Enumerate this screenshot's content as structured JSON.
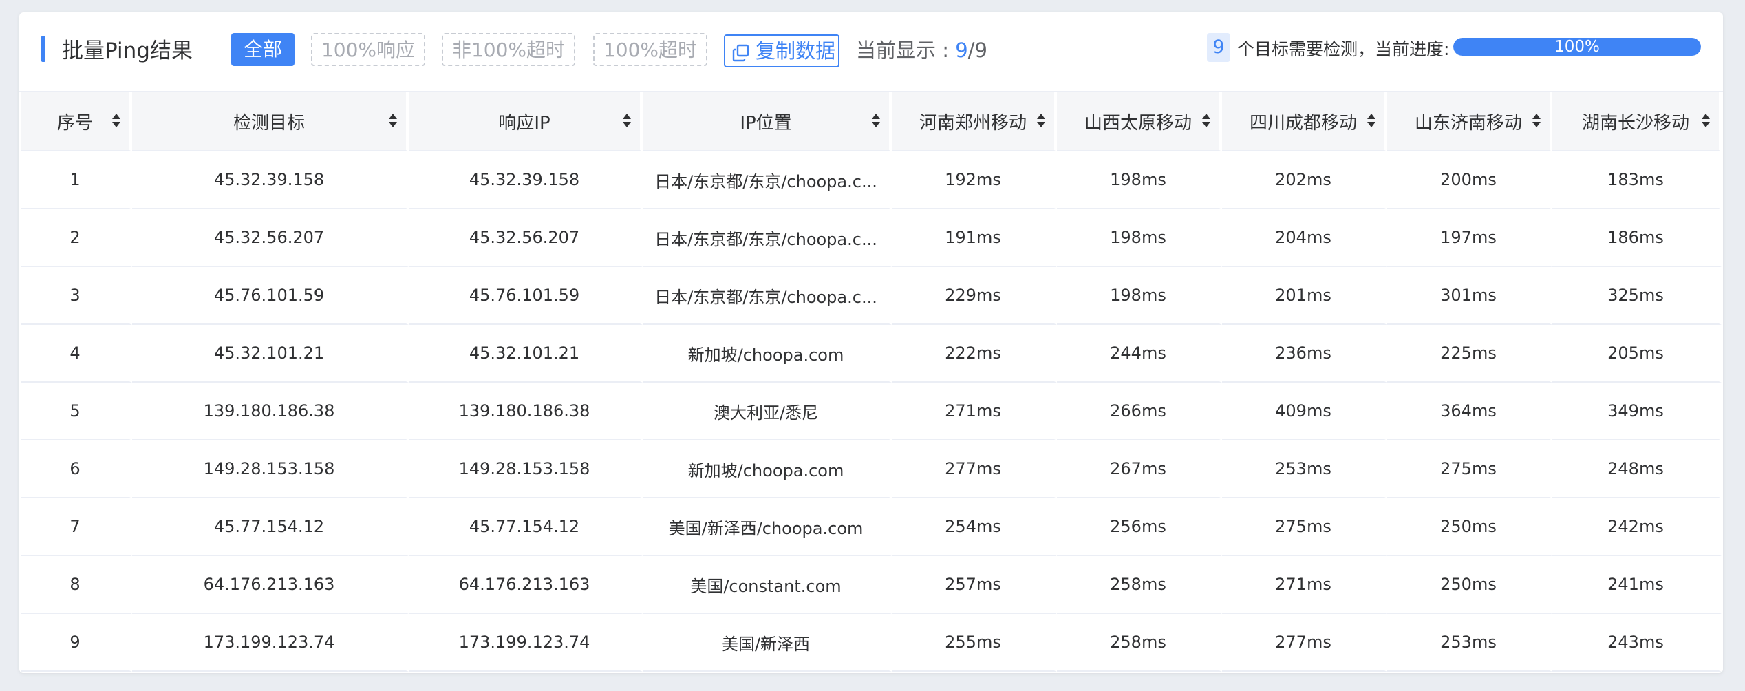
{
  "header": {
    "title": "批量Ping结果",
    "filters": [
      {
        "label": "全部",
        "active": true
      },
      {
        "label": "100%响应",
        "active": false
      },
      {
        "label": "非100%超时",
        "active": false
      },
      {
        "label": "100%超时",
        "active": false
      }
    ],
    "copy_label": "复制数据",
    "showing_label": "当前显示 :",
    "showing_current": "9",
    "showing_total": "9",
    "target_count": "9",
    "progress_text": "个目标需要检测，当前进度:",
    "progress_value": 100,
    "progress_label": "100%"
  },
  "colors": {
    "accent": "#3f84f5",
    "header_bg": "#f5f6f8",
    "border": "#ebeef5"
  },
  "table": {
    "columns": [
      "序号",
      "检测目标",
      "响应IP",
      "IP位置",
      "河南郑州移动",
      "山西太原移动",
      "四川成都移动",
      "山东济南移动",
      "湖南长沙移动"
    ],
    "rows": [
      [
        "1",
        "45.32.39.158",
        "45.32.39.158",
        "日本/东京都/东京/choopa.c...",
        "192ms",
        "198ms",
        "202ms",
        "200ms",
        "183ms"
      ],
      [
        "2",
        "45.32.56.207",
        "45.32.56.207",
        "日本/东京都/东京/choopa.c...",
        "191ms",
        "198ms",
        "204ms",
        "197ms",
        "186ms"
      ],
      [
        "3",
        "45.76.101.59",
        "45.76.101.59",
        "日本/东京都/东京/choopa.c...",
        "229ms",
        "198ms",
        "201ms",
        "301ms",
        "325ms"
      ],
      [
        "4",
        "45.32.101.21",
        "45.32.101.21",
        "新加坡/choopa.com",
        "222ms",
        "244ms",
        "236ms",
        "225ms",
        "205ms"
      ],
      [
        "5",
        "139.180.186.38",
        "139.180.186.38",
        "澳大利亚/悉尼",
        "271ms",
        "266ms",
        "409ms",
        "364ms",
        "349ms"
      ],
      [
        "6",
        "149.28.153.158",
        "149.28.153.158",
        "新加坡/choopa.com",
        "277ms",
        "267ms",
        "253ms",
        "275ms",
        "248ms"
      ],
      [
        "7",
        "45.77.154.12",
        "45.77.154.12",
        "美国/新泽西/choopa.com",
        "254ms",
        "256ms",
        "275ms",
        "250ms",
        "242ms"
      ],
      [
        "8",
        "64.176.213.163",
        "64.176.213.163",
        "美国/constant.com",
        "257ms",
        "258ms",
        "271ms",
        "250ms",
        "241ms"
      ],
      [
        "9",
        "173.199.123.74",
        "173.199.123.74",
        "美国/新泽西",
        "255ms",
        "258ms",
        "277ms",
        "253ms",
        "243ms"
      ]
    ]
  }
}
